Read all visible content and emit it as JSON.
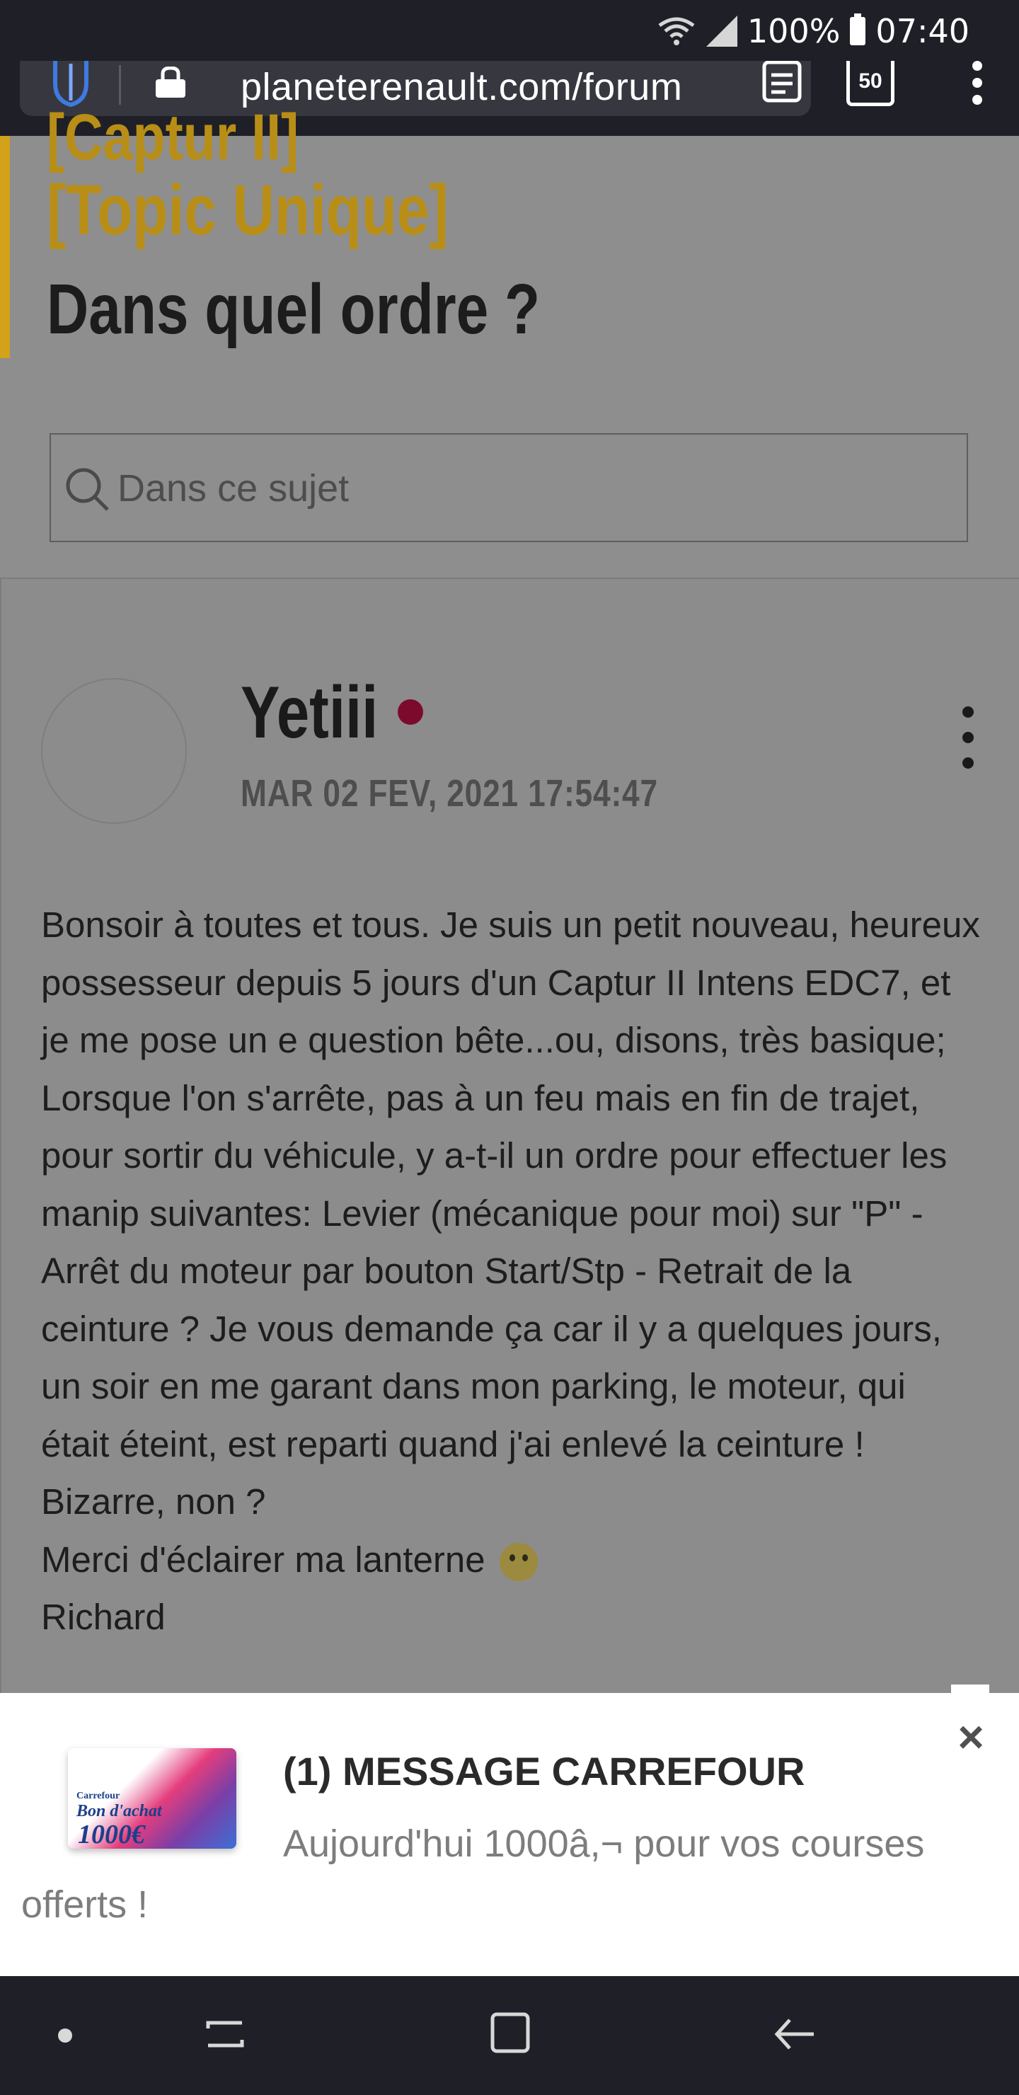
{
  "status_bar": {
    "battery": "100%",
    "time": "07:40"
  },
  "browser": {
    "url": "planeterenault.com/forum",
    "tabs_count": "50"
  },
  "topic": {
    "title_partial": "[Captur II]",
    "title_tag": "[Topic Unique]",
    "title_main": "Dans quel ordre ?",
    "search_placeholder": "Dans ce sujet"
  },
  "post": {
    "author": "Yetiii",
    "date": "MAR 02 FEV, 2021 17:54:47",
    "paragraphs": [
      "Bonsoir à toutes et tous. Je suis un petit nouveau, heureux possesseur depuis 5 jours d'un Captur II Intens EDC7, et je me pose un e question bête...ou, disons, très basique;",
      "Lorsque l'on s'arrête, pas à un feu mais en fin de trajet, pour sortir du véhicule, y a-t-il un ordre pour effectuer les manip suivantes: Levier (mécanique pour moi) sur \"P\" - Arrêt du moteur par bouton Start/Stp - Retrait de la ceinture ? Je vous demande ça car il y a quelques jours, un soir en me garant dans mon parking, le moteur, qui était éteint, est reparti quand j'ai enlevé la ceinture ! Bizarre, non ?",
      "Merci d'éclairer ma lanterne",
      "Richard"
    ]
  },
  "ad": {
    "title": "(1) MESSAGE CARREFOUR",
    "text": "Aujourd'hui 1000â,¬ pour vos courses offerts !",
    "card_brand": "Carrefour",
    "card_title": "Bon d'achat",
    "card_amount": "1000€",
    "close_glyph": "×"
  }
}
